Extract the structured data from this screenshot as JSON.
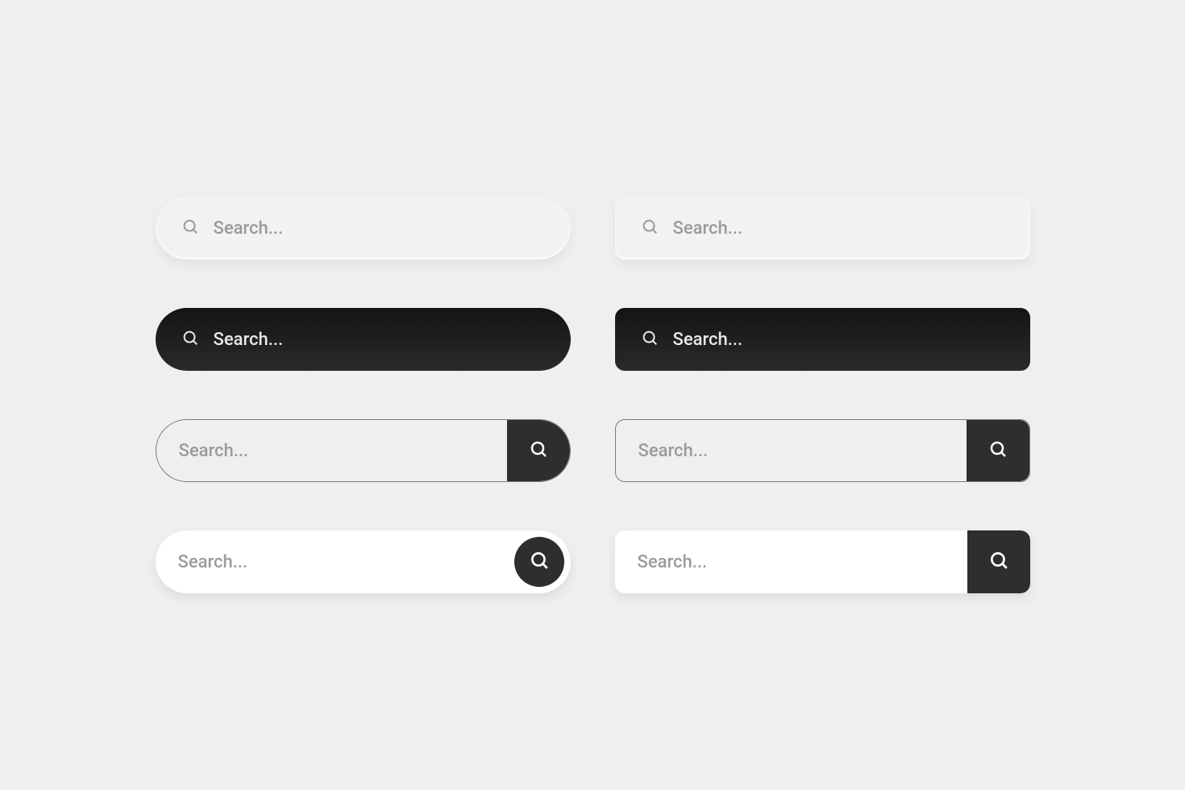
{
  "placeholder": "Search...",
  "variants": [
    {
      "id": "light-pill-neumorphic",
      "icon_left": true,
      "button": false
    },
    {
      "id": "light-rect-neumorphic",
      "icon_left": true,
      "button": false
    },
    {
      "id": "dark-pill",
      "icon_left": true,
      "button": false
    },
    {
      "id": "dark-rect",
      "icon_left": true,
      "button": false
    },
    {
      "id": "outlined-pill-button",
      "icon_left": false,
      "button": true
    },
    {
      "id": "outlined-rect-button",
      "icon_left": false,
      "button": true
    },
    {
      "id": "white-pill-roundbutton",
      "icon_left": false,
      "button": true
    },
    {
      "id": "white-rect-button",
      "icon_left": false,
      "button": true
    }
  ]
}
